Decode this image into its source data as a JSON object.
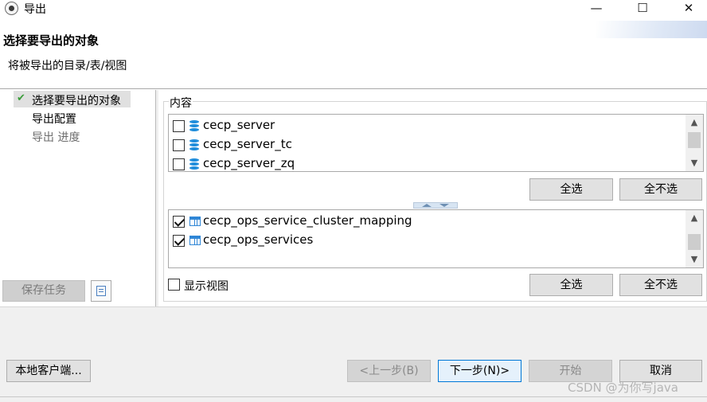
{
  "window": {
    "title": "导出",
    "minimize_label": "—",
    "maximize_label": "☐",
    "close_label": "✕"
  },
  "header": {
    "title": "选择要导出的对象",
    "subtitle": "将被导出的目录/表/视图"
  },
  "nav": {
    "items": [
      {
        "label": "选择要导出的对象",
        "state": "done"
      },
      {
        "label": "导出配置",
        "state": "pending"
      },
      {
        "label": "导出 进度",
        "state": "disabled"
      }
    ],
    "save_task_label": "保存任务"
  },
  "content": {
    "group_label": "内容",
    "top_list": [
      {
        "label": "cecp_server",
        "checked": false,
        "icon": "database-icon"
      },
      {
        "label": "cecp_server_tc",
        "checked": false,
        "icon": "database-icon"
      },
      {
        "label": "cecp_server_zq",
        "checked": false,
        "icon": "database-icon"
      }
    ],
    "bottom_list": [
      {
        "label": "cecp_ops_service_cluster_mapping",
        "checked": true,
        "icon": "table-icon"
      },
      {
        "label": "cecp_ops_services",
        "checked": true,
        "icon": "table-icon"
      }
    ],
    "select_all_label": "全选",
    "select_none_label": "全不选",
    "show_view_label": "显示视图",
    "show_view_checked": false
  },
  "footer": {
    "local_client_label": "本地客户端...",
    "prev_label": "<上一步(B)",
    "next_label": "下一步(N)>",
    "start_label": "开始",
    "cancel_label": "取消"
  },
  "watermark": "CSDN @为你写java",
  "colors": {
    "accent": "#0078d7",
    "check_green": "#3a9d3a",
    "db_icon": "#1f8ddb"
  }
}
